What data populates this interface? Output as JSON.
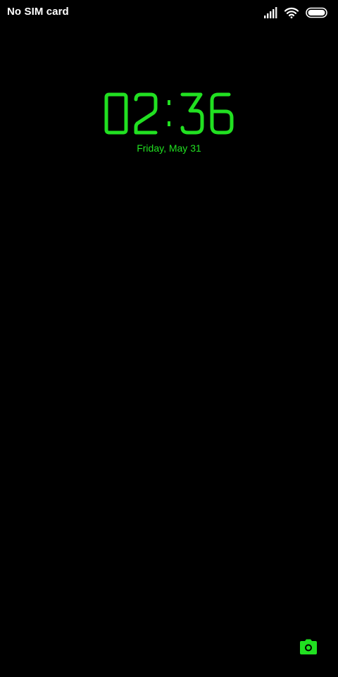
{
  "status_bar": {
    "carrier": "No SIM card",
    "icons": [
      "signal-icon",
      "wifi-icon",
      "battery-icon"
    ]
  },
  "lockscreen": {
    "time": "02:36",
    "date": "Friday, May 31"
  },
  "shortcuts": {
    "camera_icon": "camera-icon"
  },
  "colors": {
    "background": "#000000",
    "accent": "#21E021",
    "status_text": "#FFFFFF"
  }
}
